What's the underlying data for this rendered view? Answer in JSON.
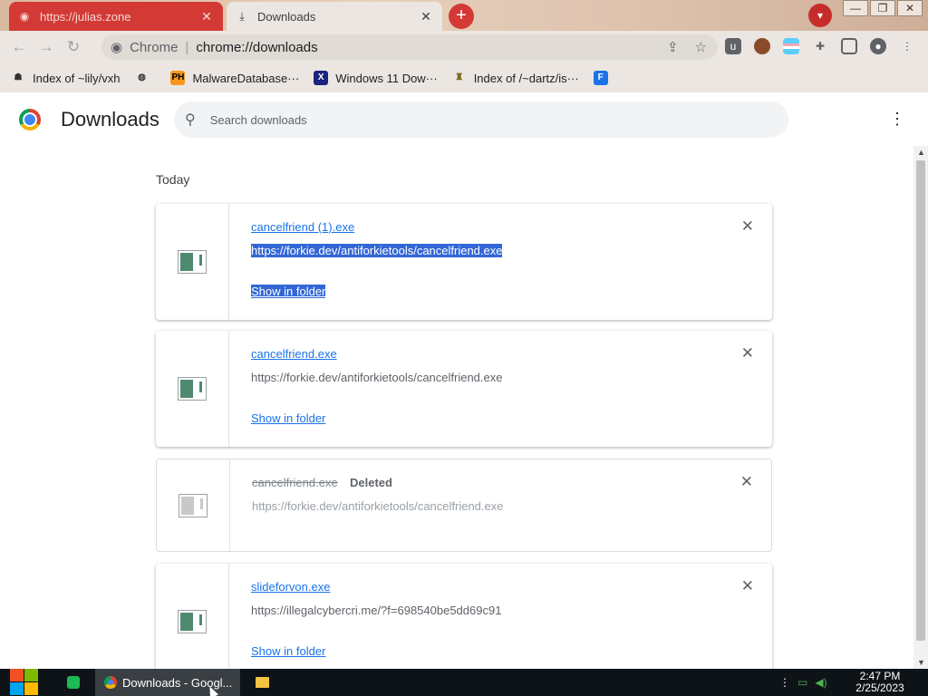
{
  "tabs": [
    {
      "title": "https://julias.zone",
      "icon": "globe-icon",
      "close": "✕"
    },
    {
      "title": "Downloads",
      "icon": "download-icon",
      "close": "✕"
    }
  ],
  "window": {
    "minimize": "—",
    "maximize": "❐",
    "close": "✕"
  },
  "toolbar": {
    "omnibox_chip": "Chrome",
    "omnibox_url": "chrome://downloads"
  },
  "bookmarks": [
    {
      "label": "Index of ~lily/vxh",
      "icon": "index-icon"
    },
    {
      "label": "",
      "icon": "globe-icon"
    },
    {
      "label": "MalwareDatabase···",
      "icon": "ph-icon",
      "icon_text": "PH"
    },
    {
      "label": "Windows 11 Dow···",
      "icon": "x-icon",
      "icon_text": "X"
    },
    {
      "label": "Index of /~dartz/is···",
      "icon": "index-icon"
    },
    {
      "label": "",
      "icon": "bookmark-icon"
    }
  ],
  "header": {
    "title": "Downloads",
    "search_placeholder": "Search downloads"
  },
  "date_label": "Today",
  "downloads": [
    {
      "filename": "cancelfriend (1).exe",
      "url": "https://forkie.dev/antiforkietools/cancelfriend.exe",
      "action": "Show in folder"
    },
    {
      "filename": "cancelfriend.exe",
      "url": "https://forkie.dev/antiforkietools/cancelfriend.exe",
      "action": "Show in folder"
    },
    {
      "filename": "cancelfriend.exe",
      "status": "Deleted",
      "url": "https://forkie.dev/antiforkietools/cancelfriend.exe"
    },
    {
      "filename": "slideforvon.exe",
      "url": "https://illegalcybercri.me/?f=698540be5dd69c91",
      "action": "Show in folder"
    }
  ],
  "taskbar": {
    "chrome_label": "Downloads - Googl...",
    "time": "2:47 PM",
    "date": "2/25/2023"
  },
  "colors": {
    "accent": "#1a73e8",
    "tab_red": "#d33a35",
    "file_icon": "#4f8a70"
  }
}
